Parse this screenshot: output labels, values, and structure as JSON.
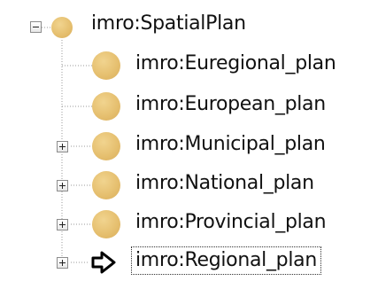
{
  "tree": {
    "root": {
      "label": "imro:SpatialPlan",
      "expander": "minus",
      "icon": "class-icon"
    },
    "children": [
      {
        "label": "imro:Euregional_plan",
        "expander": "none",
        "icon": "class-icon"
      },
      {
        "label": "imro:European_plan",
        "expander": "none",
        "icon": "class-icon"
      },
      {
        "label": "imro:Municipal_plan",
        "expander": "plus",
        "icon": "class-icon"
      },
      {
        "label": "imro:National_plan",
        "expander": "plus",
        "icon": "class-icon"
      },
      {
        "label": "imro:Provincial_plan",
        "expander": "plus",
        "icon": "class-icon"
      },
      {
        "label": "imro:Regional_plan",
        "expander": "plus",
        "icon": "arrow-icon",
        "selected": true
      }
    ]
  },
  "colors": {
    "class_icon": "#e6c070",
    "text": "#111111",
    "lines": "#9a9a9a"
  }
}
